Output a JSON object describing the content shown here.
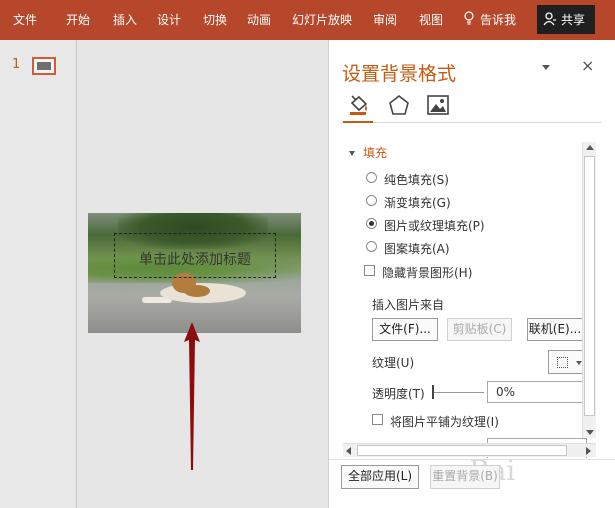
{
  "ribbon": {
    "tabs": [
      "文件",
      "开始",
      "插入",
      "设计",
      "切换",
      "动画",
      "幻灯片放映",
      "审阅",
      "视图"
    ],
    "tell_me": "告诉我",
    "share": "共享",
    "color": "#b7472a"
  },
  "thumbnails": {
    "slide_number": "1"
  },
  "slide": {
    "placeholder_text": "单击此处添加标题"
  },
  "pane": {
    "title": "设置背景格式",
    "close": "×",
    "accent": "#c55a11",
    "section": "填充",
    "options": [
      {
        "label": "纯色填充(S)",
        "checked": false
      },
      {
        "label": "渐变填充(G)",
        "checked": false
      },
      {
        "label": "图片或纹理填充(P)",
        "checked": true
      },
      {
        "label": "图案填充(A)",
        "checked": false
      }
    ],
    "hide_graphics": "隐藏背景图形(H)",
    "insert_from": "插入图片来自",
    "file_button": "文件(F)...",
    "clipboard_button": "剪贴板(C)",
    "online_button": "联机(E)...",
    "texture_label": "纹理(U)",
    "transparency_label": "透明度(T)",
    "transparency_value": "0%",
    "tile_label": "将图片平铺为纹理(I)",
    "apply_all": "全部应用(L)",
    "reset": "重置背景(B)"
  }
}
